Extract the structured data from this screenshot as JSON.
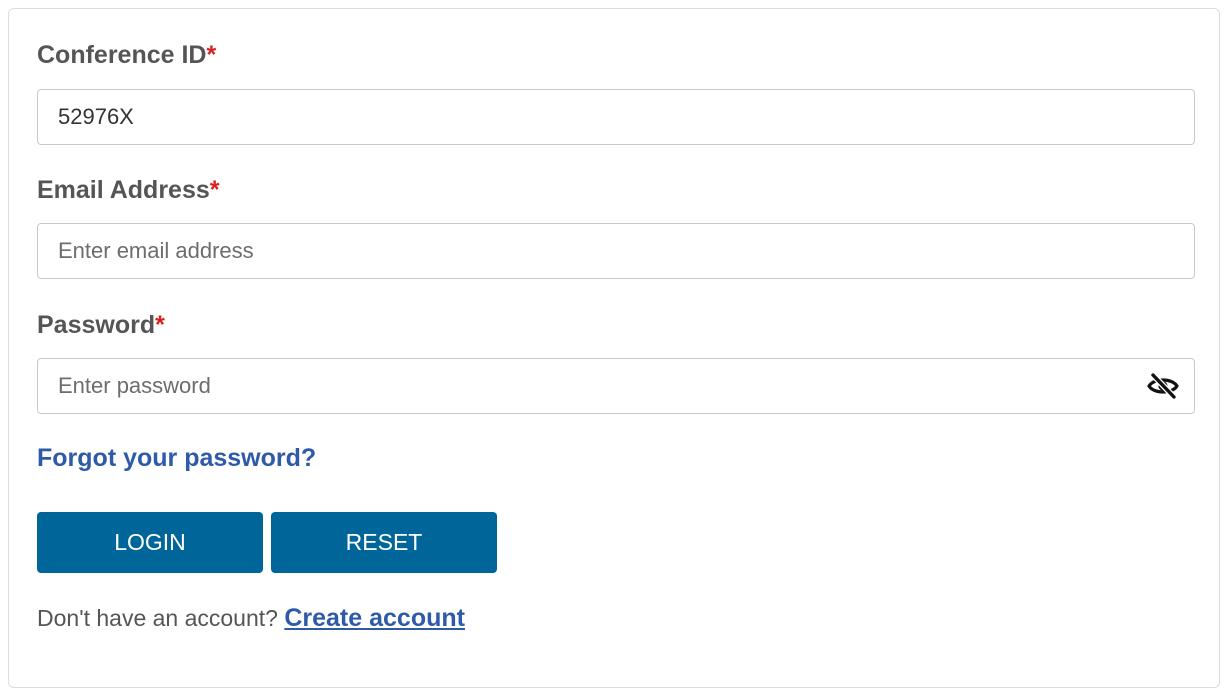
{
  "form": {
    "conference_id": {
      "label": "Conference ID",
      "required_mark": "*",
      "value": "52976X",
      "placeholder": ""
    },
    "email": {
      "label": "Email Address",
      "required_mark": "*",
      "value": "",
      "placeholder": "Enter email address"
    },
    "password": {
      "label": "Password",
      "required_mark": "*",
      "value": "",
      "placeholder": "Enter password",
      "toggle_icon": "eye-slash-icon"
    },
    "forgot_password_link": "Forgot your password?",
    "login_button": "LOGIN",
    "reset_button": "RESET",
    "no_account_text": "Don't have an account?",
    "create_account_link": "Create account"
  },
  "colors": {
    "primary_button": "#006699",
    "link": "#2f5aa8",
    "required": "#d92020",
    "label": "#555555"
  }
}
